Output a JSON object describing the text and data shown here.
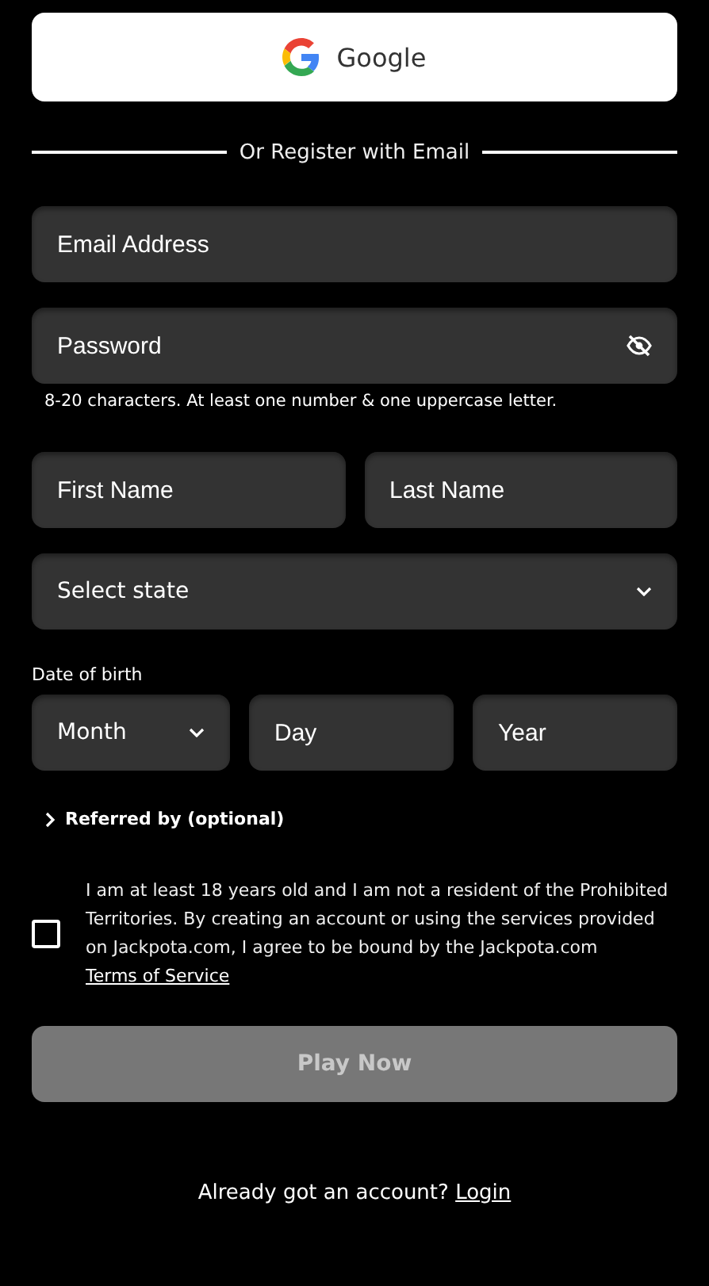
{
  "google_button": {
    "label": "Google"
  },
  "divider": {
    "label": "Or Register with Email"
  },
  "email": {
    "placeholder": "Email Address"
  },
  "password": {
    "placeholder": "Password",
    "visible": false,
    "hint": "8-20 characters. At least one number & one uppercase letter."
  },
  "first_name": {
    "placeholder": "First Name"
  },
  "last_name": {
    "placeholder": "Last Name"
  },
  "state": {
    "placeholder": "Select state"
  },
  "date_of_birth": {
    "label": "Date of birth",
    "month": {
      "placeholder": "Month"
    },
    "day": {
      "placeholder": "Day"
    },
    "year": {
      "placeholder": "Year"
    }
  },
  "referred_by": {
    "label": "Referred by (optional)",
    "expanded": false
  },
  "consent": {
    "checked": false,
    "text": "I am at least 18 years old and I am not a resident of the Prohibited Territories. By creating an account or using the services provided on Jackpota.com, I agree to be bound by the Jackpota.com",
    "link": "Terms of Service"
  },
  "play_button": {
    "label": "Play Now",
    "disabled": true
  },
  "login_prompt": {
    "text": "Already got an account?",
    "link": "Login"
  }
}
